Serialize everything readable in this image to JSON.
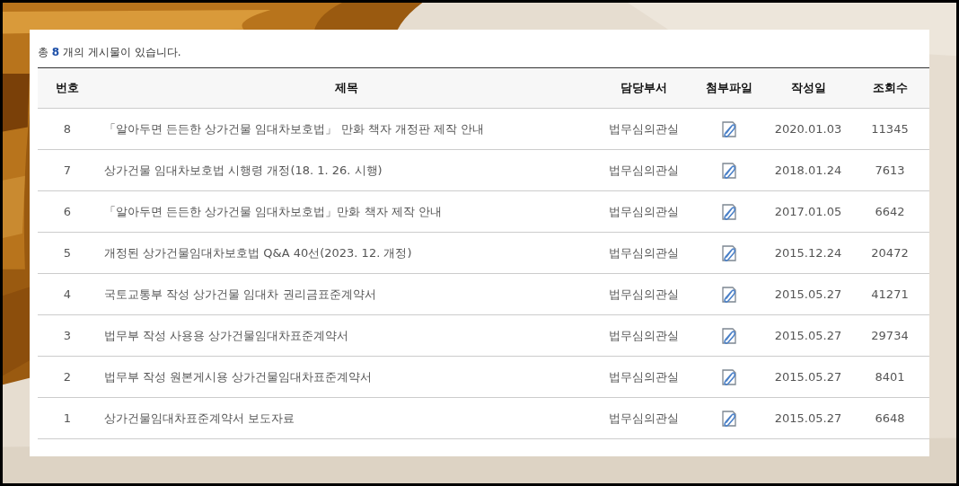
{
  "summary": "총 **8** 개의 게시물이 있습니다.",
  "table": {
    "columns": [
      "번호",
      "제목",
      "담당부서",
      "첨부파일",
      "작성일",
      "조회수"
    ],
    "rows": [
      {
        "number": "8",
        "title": "「알아두면 든든한 상가건물 임대차보호법」 만화 책자 개정판 제작 안내",
        "department": "법무심의관실",
        "attachment": true,
        "date": "2020.01.03",
        "views": "11345"
      },
      {
        "number": "7",
        "title": "상가건물 임대차보호법 시행령 개정(18. 1. 26. 시행)",
        "department": "법무심의관실",
        "attachment": true,
        "date": "2018.01.24",
        "views": "7613"
      },
      {
        "number": "6",
        "title": "「알아두면 든든한 상가건물 임대차보호법」만화 책자 제작 안내",
        "department": "법무심의관실",
        "attachment": true,
        "date": "2017.01.05",
        "views": "6642"
      },
      {
        "number": "5",
        "title": "개정된 상가건물임대차보호법 Q&A 40선(2023. 12. 개정)",
        "department": "법무심의관실",
        "attachment": true,
        "date": "2015.12.24",
        "views": "20472"
      },
      {
        "number": "4",
        "title": "국토교통부 작성 상가건물 임대차 권리금표준계약서",
        "department": "법무심의관실",
        "attachment": true,
        "date": "2015.05.27",
        "views": "41271"
      },
      {
        "number": "3",
        "title": "법무부 작성 사용용 상가건물임대차표준계약서",
        "department": "법무심의관실",
        "attachment": true,
        "date": "2015.05.27",
        "views": "29734"
      },
      {
        "number": "2",
        "title": "법무부 작성 원본게시용 상가건물임대차표준계약서",
        "department": "법무심의관실",
        "attachment": true,
        "date": "2015.05.27",
        "views": "8401"
      },
      {
        "number": "1",
        "title": "상가건물임대차표준계약서 보도자료",
        "department": "법무심의관실",
        "attachment": true,
        "date": "2015.05.27",
        "views": "6648"
      }
    ]
  }
}
